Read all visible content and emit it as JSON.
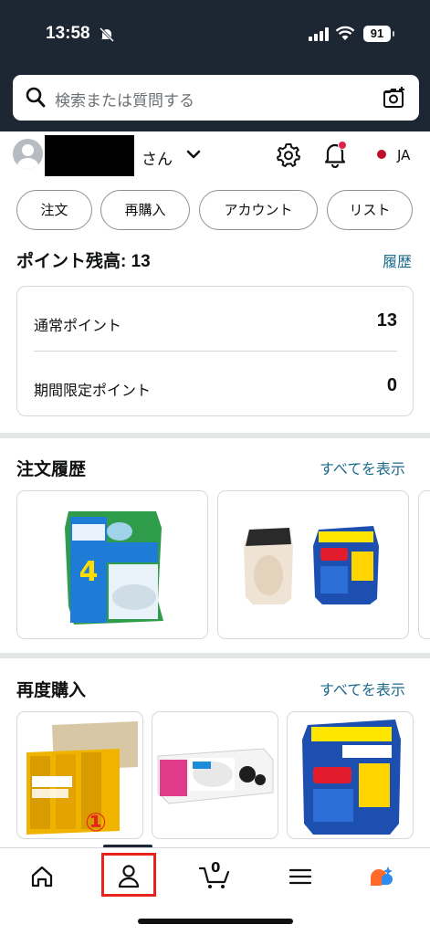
{
  "status_bar": {
    "time": "13:58",
    "battery": "91"
  },
  "search": {
    "placeholder": "検索または質問する"
  },
  "greeting": {
    "suffix": "さん",
    "language": "JA"
  },
  "pills": [
    {
      "label": "注文"
    },
    {
      "label": "再購入"
    },
    {
      "label": "アカウント"
    },
    {
      "label": "リスト"
    }
  ],
  "points": {
    "title": "ポイント残高: 13",
    "history_link": "履歴",
    "rows": [
      {
        "label": "通常ポイント",
        "value": "13"
      },
      {
        "label": "期間限定ポイント",
        "value": "0"
      }
    ]
  },
  "orders": {
    "title": "注文履歴",
    "view_all": "すべてを表示"
  },
  "rebuy": {
    "title": "再度購入",
    "view_all": "すべてを表示"
  },
  "nav": {
    "cart_count": "0"
  },
  "annotation": {
    "marker": "①"
  },
  "icons": [
    "search-icon",
    "camera-search-icon",
    "gear-icon",
    "bell-icon",
    "chevron-down-icon",
    "home-icon",
    "account-icon",
    "cart-icon",
    "menu-icon",
    "rufus-icon"
  ]
}
